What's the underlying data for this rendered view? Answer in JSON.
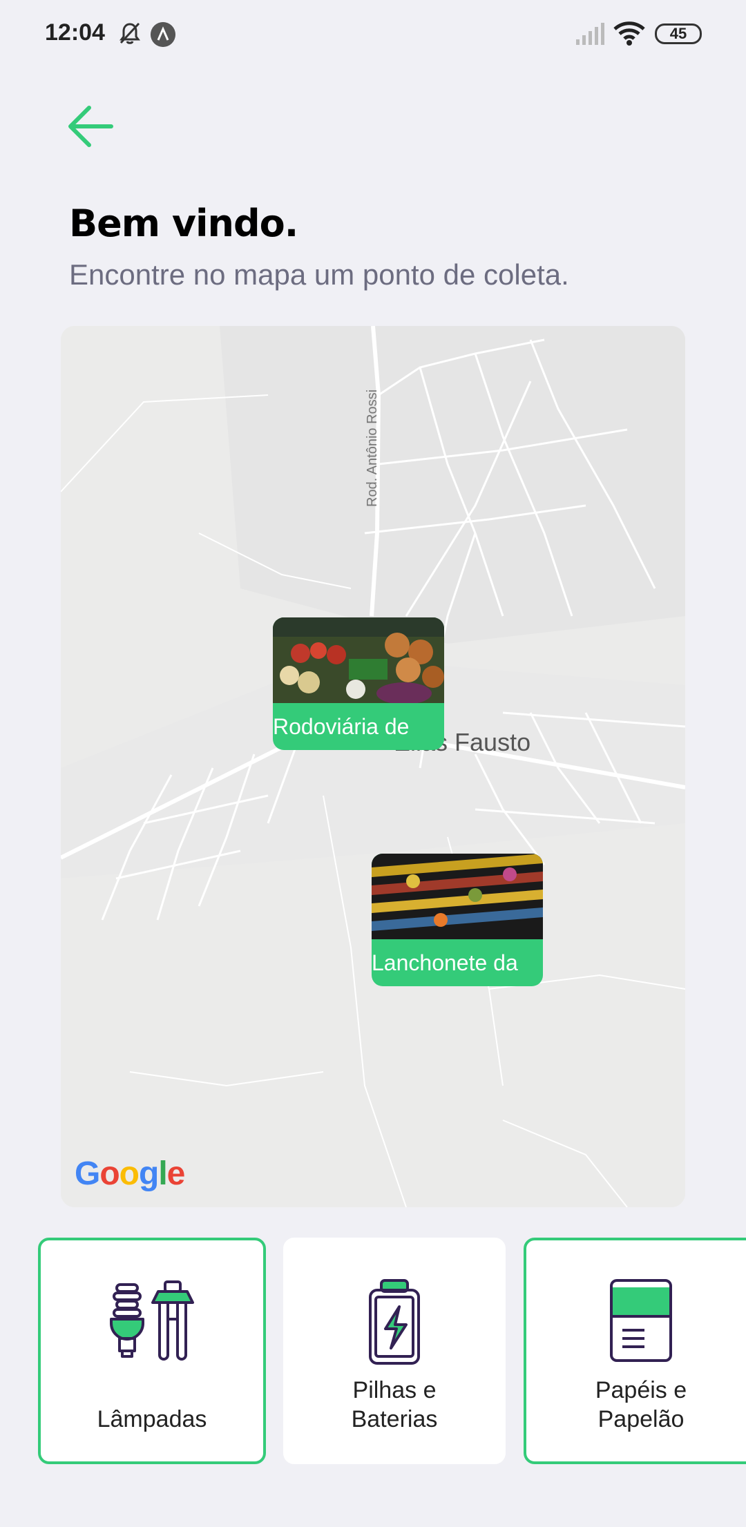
{
  "status_bar": {
    "time": "12:04",
    "battery": "45"
  },
  "header": {
    "back_icon": "arrow-left-icon",
    "title": "Bem vindo.",
    "subtitle": "Encontre no mapa um ponto de coleta."
  },
  "map": {
    "road_label": "Rod. Antônio Rossi",
    "city_label": "Elias Fausto",
    "attribution": "Google",
    "markers": [
      {
        "label": "Rodoviária de",
        "image": "vegetables-market-photo"
      },
      {
        "label": "Lanchonete da",
        "image": "spices-market-photo"
      }
    ]
  },
  "items": [
    {
      "label": "Lâmpadas",
      "icon": "lamp-icon",
      "selected": true
    },
    {
      "label": "Pilhas e\nBaterias",
      "icon": "battery-icon",
      "selected": false
    },
    {
      "label": "Papéis e\nPapelão",
      "icon": "paper-icon",
      "selected": true
    }
  ],
  "colors": {
    "accent": "#34cb79",
    "background": "#f0f0f5",
    "title": "#000000",
    "subtitle": "#6c6c80",
    "icon_stroke": "#322153"
  }
}
